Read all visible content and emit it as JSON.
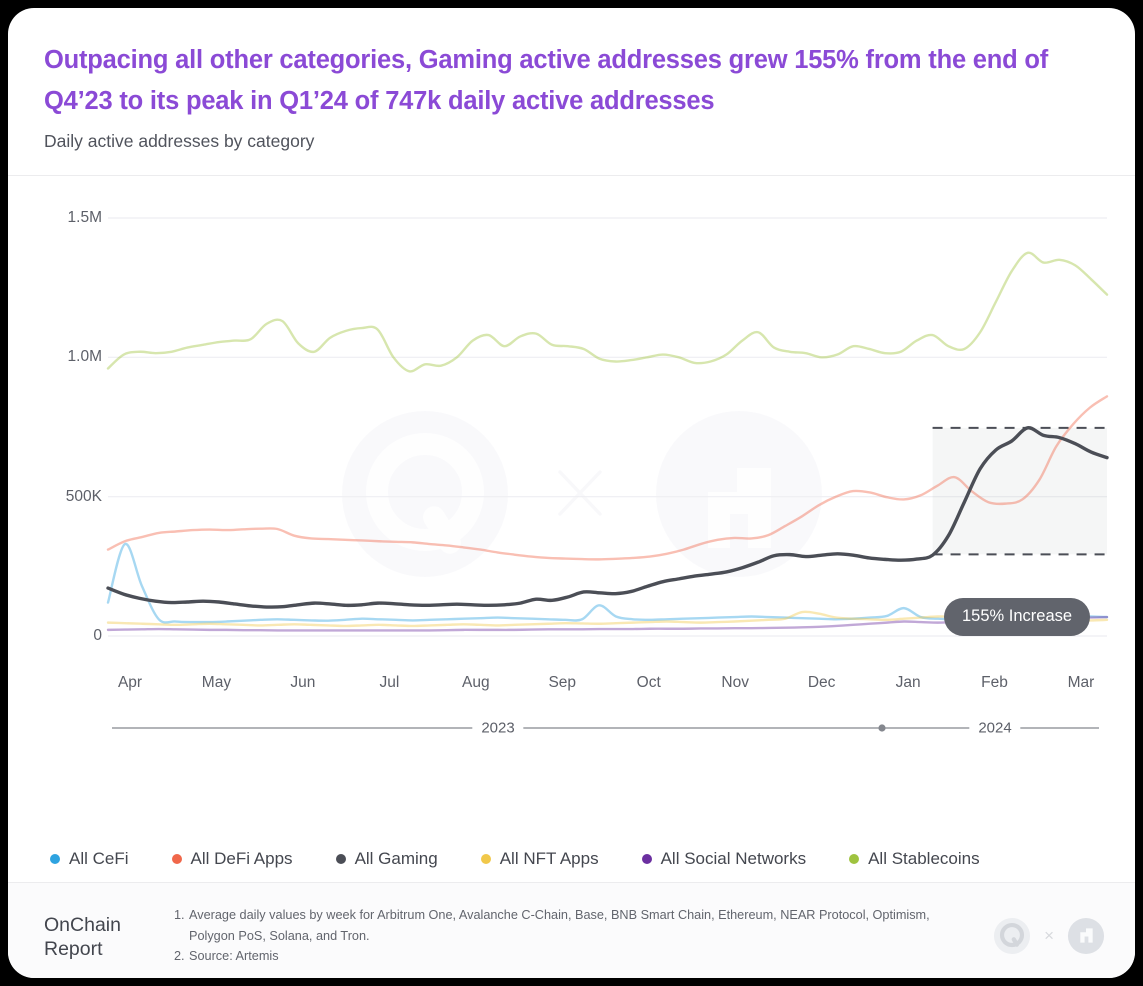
{
  "header": {
    "title": "Outpacing all other categories, Gaming active addresses grew 155% from the end of Q4’23 to its peak in Q1’24 of 747k daily active addresses",
    "subtitle": "Daily active addresses by category",
    "title_color": "#8b4ad6"
  },
  "annotation": {
    "label": "155% Increase"
  },
  "footer": {
    "brand_line1": "OnChain",
    "brand_line2": "Report",
    "notes": [
      {
        "num": "1.",
        "text": "Average daily values by week for Arbitrum One, Avalanche C-Chain, Base, BNB Smart Chain, Ethereum, NEAR Protocol, Optimism, Polygon PoS, Solana, and Tron."
      },
      {
        "num": "2.",
        "text": "Source: Artemis"
      }
    ],
    "logo_left": "q-logo-icon",
    "logo_x": "×",
    "logo_right": "artemis-logo-icon"
  },
  "watermark": {
    "left": "q-logo-watermark",
    "x": "×",
    "right": "artemis-logo-watermark"
  },
  "chart_data": {
    "type": "line",
    "title": "Daily active addresses by category",
    "xlabel": "",
    "ylabel": "",
    "ylim": [
      0,
      1500000
    ],
    "yticks": [
      0,
      500000,
      1000000,
      1500000
    ],
    "ytick_labels": [
      "0",
      "500K",
      "1.0M",
      "1.5M"
    ],
    "grid": true,
    "legend_position": "bottom",
    "x_tick_labels": [
      "Apr",
      "May",
      "Jun",
      "Jul",
      "Aug",
      "Sep",
      "Oct",
      "Nov",
      "Dec",
      "Jan",
      "Feb",
      "Mar"
    ],
    "year_bands": [
      {
        "label": "2023",
        "from": "Apr",
        "to": "Dec"
      },
      {
        "label": "2024",
        "from": "Jan",
        "to": "Mar"
      }
    ],
    "highlight_band": {
      "label": "155% Increase",
      "from_value": 293000,
      "to_value": 747000,
      "start_x": "Jan-late",
      "end_x": "Mar"
    },
    "series": [
      {
        "name": "All CeFi",
        "color": "#2ea3e0",
        "values": [
          120000,
          330000,
          180000,
          60000,
          52000,
          50000,
          50000,
          52000,
          55000,
          58000,
          60000,
          58000,
          56000,
          55000,
          58000,
          62000,
          60000,
          58000,
          56000,
          58000,
          60000,
          62000,
          64000,
          66000,
          64000,
          62000,
          60000,
          58000,
          60000,
          110000,
          70000,
          60000,
          58000,
          60000,
          62000,
          64000,
          66000,
          68000,
          70000,
          68000,
          66000,
          64000,
          62000,
          60000,
          62000,
          66000,
          72000,
          100000,
          68000,
          62000,
          60000,
          66000,
          100000,
          70000,
          66000,
          70000,
          75000,
          72000,
          70000,
          68000
        ]
      },
      {
        "name": "All DeFi Apps",
        "color": "#f0674a",
        "values": [
          310000,
          340000,
          355000,
          370000,
          375000,
          380000,
          382000,
          380000,
          383000,
          385000,
          384000,
          360000,
          350000,
          348000,
          345000,
          343000,
          340000,
          338000,
          336000,
          330000,
          325000,
          318000,
          310000,
          300000,
          292000,
          285000,
          280000,
          278000,
          276000,
          275000,
          277000,
          280000,
          285000,
          295000,
          310000,
          330000,
          345000,
          352000,
          350000,
          362000,
          395000,
          430000,
          470000,
          500000,
          520000,
          515000,
          498000,
          490000,
          505000,
          540000,
          570000,
          520000,
          480000,
          475000,
          490000,
          560000,
          680000,
          760000,
          820000,
          860000
        ]
      },
      {
        "name": "All Gaming",
        "color": "#4b4e56",
        "values": [
          172000,
          150000,
          135000,
          125000,
          120000,
          122000,
          125000,
          122000,
          115000,
          108000,
          104000,
          105000,
          112000,
          118000,
          115000,
          110000,
          112000,
          118000,
          116000,
          112000,
          110000,
          112000,
          114000,
          112000,
          110000,
          112000,
          118000,
          132000,
          128000,
          140000,
          158000,
          155000,
          152000,
          160000,
          178000,
          195000,
          205000,
          215000,
          222000,
          230000,
          245000,
          265000,
          288000,
          292000,
          285000,
          290000,
          295000,
          290000,
          280000,
          275000,
          272000,
          276000,
          290000,
          360000,
          480000,
          600000,
          668000,
          700000,
          747000,
          720000,
          712000,
          690000,
          660000,
          640000
        ]
      },
      {
        "name": "All NFT Apps",
        "color": "#f1c84a",
        "values": [
          48000,
          46000,
          44000,
          42000,
          40000,
          42000,
          44000,
          42000,
          40000,
          38000,
          40000,
          42000,
          40000,
          38000,
          36000,
          38000,
          40000,
          38000,
          36000,
          38000,
          40000,
          42000,
          40000,
          38000,
          40000,
          42000,
          44000,
          46000,
          45000,
          44000,
          46000,
          48000,
          50000,
          52000,
          50000,
          48000,
          50000,
          52000,
          55000,
          58000,
          62000,
          86000,
          80000,
          66000,
          62000,
          60000,
          58000,
          62000,
          66000,
          70000,
          68000,
          62000,
          58000,
          60000,
          68000,
          80000,
          72000,
          60000,
          56000,
          58000
        ]
      },
      {
        "name": "All Social Networks",
        "color": "#6b2fa0",
        "values": [
          22000,
          23000,
          24000,
          25000,
          24000,
          23000,
          22000,
          22000,
          21000,
          21000,
          20000,
          20000,
          20000,
          20000,
          20000,
          20000,
          20000,
          20000,
          20000,
          20000,
          21000,
          22000,
          22000,
          22000,
          22000,
          23000,
          24000,
          24000,
          24000,
          25000,
          25000,
          25000,
          26000,
          26000,
          26000,
          27000,
          27000,
          28000,
          28000,
          29000,
          30000,
          31000,
          33000,
          36000,
          40000,
          44000,
          48000,
          52000,
          50000,
          48000,
          50000,
          52000,
          54000,
          56000,
          58000,
          60000,
          62000,
          64000,
          66000,
          68000
        ]
      },
      {
        "name": "All Stablecoins",
        "color": "#9fc33f",
        "values": [
          960000,
          1010000,
          1020000,
          1015000,
          1020000,
          1035000,
          1045000,
          1055000,
          1060000,
          1065000,
          1120000,
          1130000,
          1050000,
          1020000,
          1070000,
          1095000,
          1105000,
          1100000,
          1000000,
          950000,
          975000,
          970000,
          1000000,
          1060000,
          1080000,
          1040000,
          1075000,
          1085000,
          1045000,
          1040000,
          1030000,
          995000,
          985000,
          990000,
          1000000,
          1010000,
          1000000,
          980000,
          985000,
          1010000,
          1060000,
          1090000,
          1035000,
          1020000,
          1015000,
          1000000,
          1010000,
          1040000,
          1030000,
          1015000,
          1020000,
          1060000,
          1080000,
          1040000,
          1030000,
          1090000,
          1200000,
          1310000,
          1375000,
          1340000,
          1350000,
          1330000,
          1280000,
          1225000
        ]
      }
    ]
  }
}
